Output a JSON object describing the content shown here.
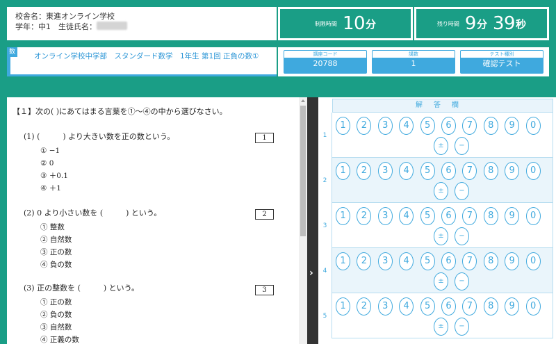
{
  "header": {
    "school_line": "校舎名：東進オンライン学校",
    "student_line": "学年：中1　生徒氏名：",
    "limit_label": "制限時間",
    "limit_num": "10",
    "limit_unit": "分",
    "remain_label": "残り時間",
    "remain_min": "9",
    "remain_min_unit": "分",
    "remain_sec": "39",
    "remain_sec_unit": "秒"
  },
  "course": {
    "badge": "数",
    "title": "オンライン学校中学部　スタンダード数学　1年生 第1回 正負の数①"
  },
  "meta": [
    {
      "label": "講座コード",
      "value": "20788"
    },
    {
      "label": "講数",
      "value": "1"
    },
    {
      "label": "テスト種別",
      "value": "確認テスト"
    }
  ],
  "question": {
    "instruction": "【１】次の(  )にあてはまる言葉を①〜④の中から選びなさい。",
    "items": [
      {
        "stem": "(1)  (　　　) より大きい数を正の数という。",
        "box": "1",
        "options": [
          "①  −1",
          "②  0",
          "③  ＋0.1",
          "④  ＋1"
        ]
      },
      {
        "stem": "(2)  0 より小さい数を (　　　) という。",
        "box": "2",
        "options": [
          "①  整数",
          "②  自然数",
          "③  正の数",
          "④  負の数"
        ]
      },
      {
        "stem": "(3)  正の整数を (　　　) という。",
        "box": "3",
        "options": [
          "①  正の数",
          "②  負の数",
          "③  自然数",
          "④  正義の数"
        ]
      }
    ]
  },
  "answer": {
    "header": "解答欄",
    "rows": [
      "1",
      "2",
      "3",
      "4",
      "5"
    ],
    "choices": [
      "1",
      "2",
      "3",
      "4",
      "5",
      "6",
      "7",
      "8",
      "9",
      "0"
    ],
    "signs": [
      "±",
      "−"
    ]
  },
  "divider_arrow": "›"
}
